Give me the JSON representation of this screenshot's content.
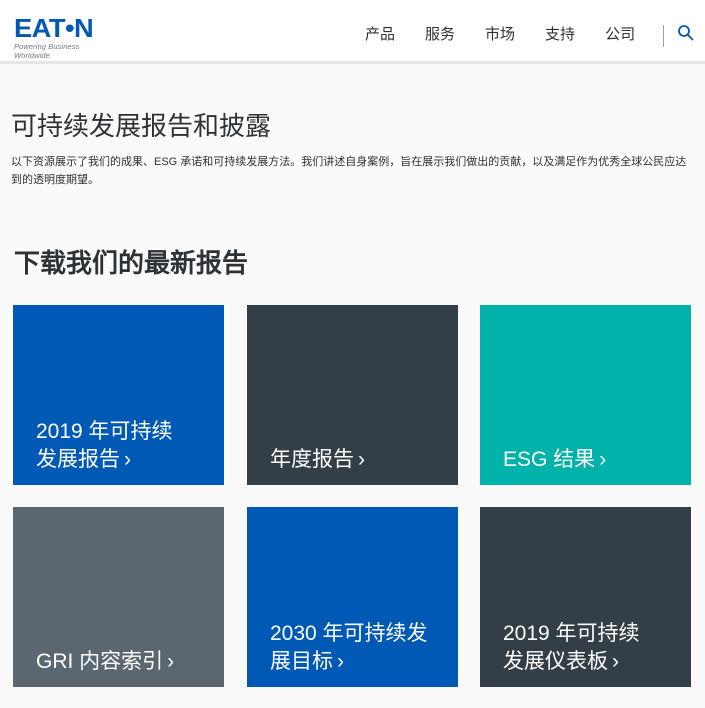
{
  "header": {
    "logo_text": "EAT•N",
    "logo_tagline": "Powering Business Worldwide",
    "nav": [
      "产品",
      "服务",
      "市场",
      "支持",
      "公司"
    ]
  },
  "intro": {
    "title": "可持续发展报告和披露",
    "description": "以下资源展示了我们的成果、ESG 承诺和可持续发展方法。我们讲述自身案例，旨在展示我们做出的贡献，以及满足作为优秀全球公民应达到的透明度期望。"
  },
  "section": {
    "title": "下载我们的最新报告"
  },
  "tiles": [
    {
      "line1": "2019 年可持续",
      "line2": "发展报告",
      "chevron": "›"
    },
    {
      "line1": "",
      "line2": "年度报告",
      "chevron": "›"
    },
    {
      "line1": "",
      "line2": "ESG 结果",
      "chevron": "›"
    },
    {
      "line1": "",
      "line2": "GRI 内容索引",
      "chevron": "›"
    },
    {
      "line1": "2030 年可持续发",
      "line2": "展目标",
      "chevron": "›"
    },
    {
      "line1": "2019 年可持续",
      "line2": "发展仪表板",
      "chevron": "›"
    }
  ],
  "colors": {
    "brand_blue": "#0059b5",
    "dark_slate": "#333e47",
    "teal": "#00b2a9",
    "gray_slate": "#5b6770"
  }
}
